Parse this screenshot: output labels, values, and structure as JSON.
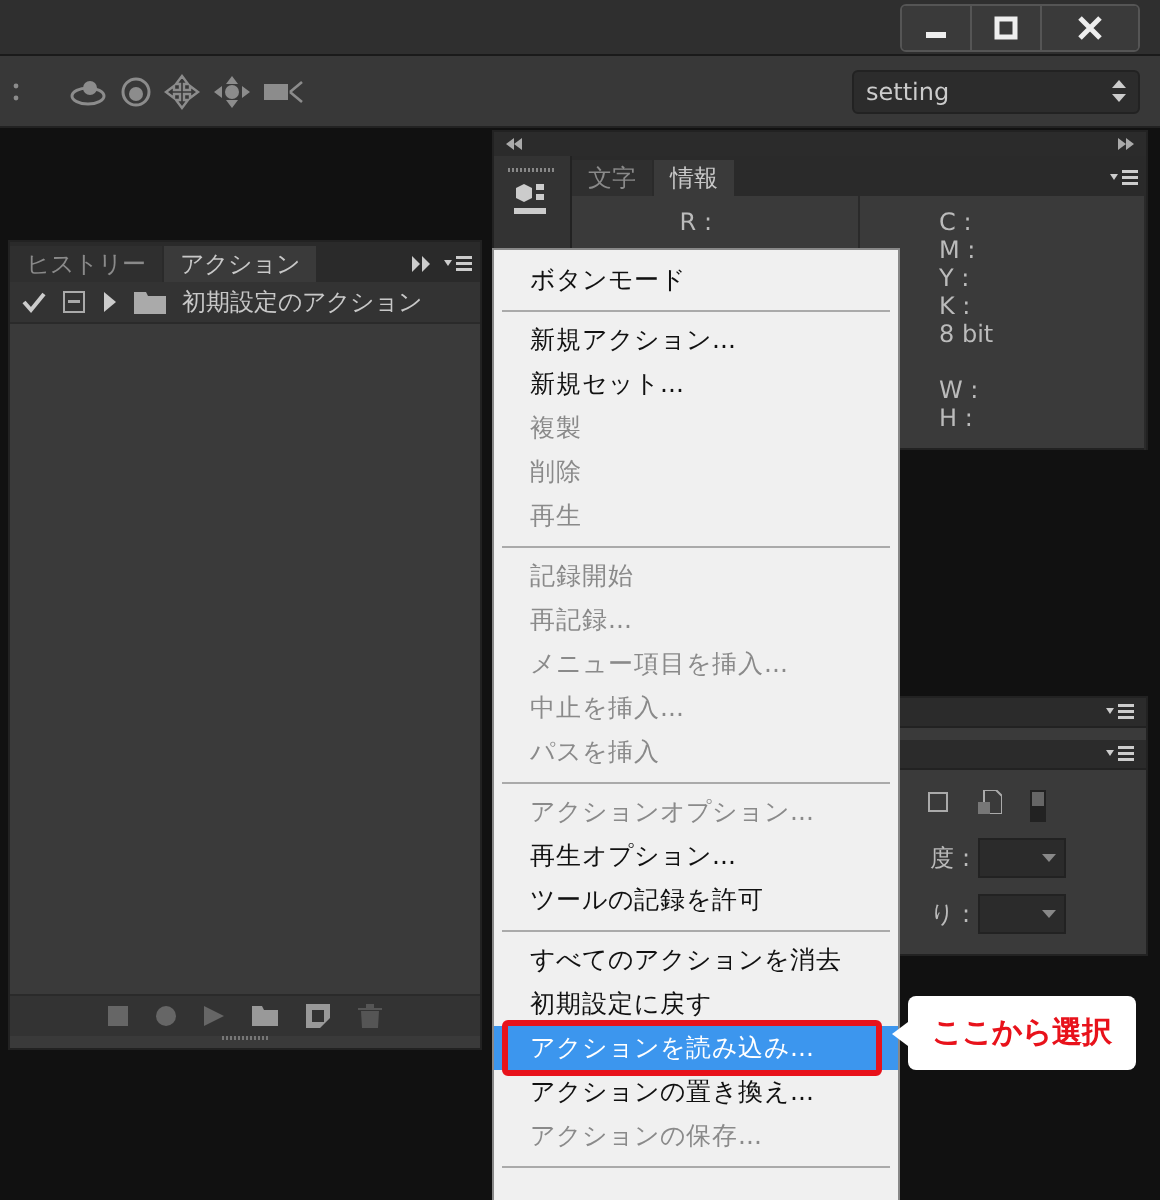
{
  "toolbar": {
    "preset": "setting"
  },
  "actions_panel": {
    "tabs": [
      {
        "label": "ヒストリー",
        "selected": false
      },
      {
        "label": "アクション",
        "selected": true
      }
    ],
    "actions": [
      {
        "checked": true,
        "dialog": true,
        "expanded": false,
        "label": "初期設定のアクション"
      }
    ]
  },
  "info_panel": {
    "tabs": [
      {
        "label": "文字",
        "selected": false
      },
      {
        "label": "情報",
        "selected": true
      }
    ],
    "rgb_labels": [
      "R :"
    ],
    "cmyk_labels": [
      "C :",
      "M :",
      "Y :",
      "K :"
    ],
    "bit_depth": "8 bit",
    "size_labels": [
      "W :",
      "H :"
    ]
  },
  "lower_panel": {
    "field_labels": [
      "度 :",
      "り :"
    ]
  },
  "menu": {
    "items": [
      {
        "kind": "item",
        "label": "ボタンモード",
        "disabled": false,
        "selected": false
      },
      {
        "kind": "separator"
      },
      {
        "kind": "item",
        "label": "新規アクション...",
        "disabled": false,
        "selected": false
      },
      {
        "kind": "item",
        "label": "新規セット...",
        "disabled": false,
        "selected": false
      },
      {
        "kind": "item",
        "label": "複製",
        "disabled": true,
        "selected": false
      },
      {
        "kind": "item",
        "label": "削除",
        "disabled": true,
        "selected": false
      },
      {
        "kind": "item",
        "label": "再生",
        "disabled": true,
        "selected": false
      },
      {
        "kind": "separator"
      },
      {
        "kind": "item",
        "label": "記録開始",
        "disabled": true,
        "selected": false
      },
      {
        "kind": "item",
        "label": "再記録...",
        "disabled": true,
        "selected": false
      },
      {
        "kind": "item",
        "label": "メニュー項目を挿入...",
        "disabled": true,
        "selected": false
      },
      {
        "kind": "item",
        "label": "中止を挿入...",
        "disabled": true,
        "selected": false
      },
      {
        "kind": "item",
        "label": "パスを挿入",
        "disabled": true,
        "selected": false
      },
      {
        "kind": "separator"
      },
      {
        "kind": "item",
        "label": "アクションオプション...",
        "disabled": true,
        "selected": false
      },
      {
        "kind": "item",
        "label": "再生オプション...",
        "disabled": false,
        "selected": false
      },
      {
        "kind": "item",
        "label": "ツールの記録を許可",
        "disabled": false,
        "selected": false
      },
      {
        "kind": "separator"
      },
      {
        "kind": "item",
        "label": "すべてのアクションを消去",
        "disabled": false,
        "selected": false
      },
      {
        "kind": "item",
        "label": "初期設定に戻す",
        "disabled": false,
        "selected": false
      },
      {
        "kind": "item",
        "label": "アクションを読み込み...",
        "disabled": false,
        "selected": true
      },
      {
        "kind": "item",
        "label": "アクションの置き換え...",
        "disabled": false,
        "selected": false
      },
      {
        "kind": "item",
        "label": "アクションの保存...",
        "disabled": true,
        "selected": false
      },
      {
        "kind": "separator"
      }
    ]
  },
  "callout": {
    "text": "ここから選択"
  }
}
